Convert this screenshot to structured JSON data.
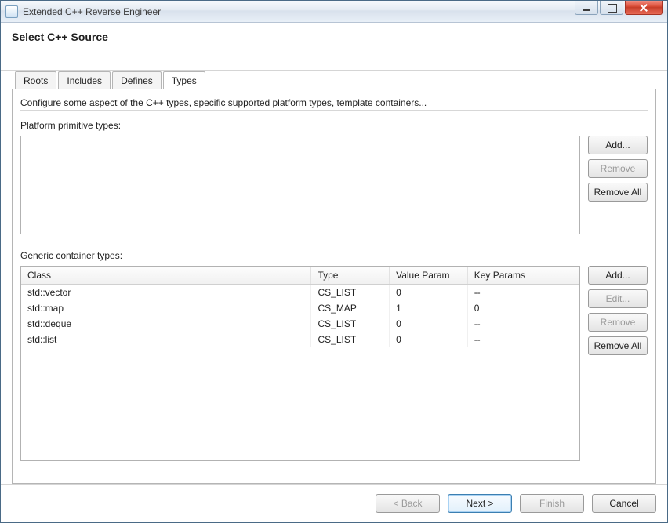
{
  "window": {
    "title": "Extended C++ Reverse Engineer"
  },
  "banner": {
    "heading": "Select C++ Source"
  },
  "tabs": [
    {
      "id": "roots",
      "label": "Roots",
      "active": false
    },
    {
      "id": "includes",
      "label": "Includes",
      "active": false
    },
    {
      "id": "defines",
      "label": "Defines",
      "active": false
    },
    {
      "id": "types",
      "label": "Types",
      "active": true
    }
  ],
  "panel": {
    "description": "Configure some aspect of the C++ types, specific supported platform types, template containers...",
    "primitive_label": "Platform primitive types:",
    "container_label": "Generic container types:"
  },
  "primitive_buttons": {
    "add": "Add...",
    "remove": "Remove",
    "remove_all": "Remove All"
  },
  "container_buttons": {
    "add": "Add...",
    "edit": "Edit...",
    "remove": "Remove",
    "remove_all": "Remove All"
  },
  "table": {
    "headers": {
      "class": "Class",
      "type": "Type",
      "value_param": "Value Param",
      "key_params": "Key Params"
    },
    "rows": [
      {
        "class": "std::vector",
        "type": "CS_LIST",
        "value_param": "0",
        "key_params": "--"
      },
      {
        "class": "std::map",
        "type": "CS_MAP",
        "value_param": "1",
        "key_params": "0"
      },
      {
        "class": "std::deque",
        "type": "CS_LIST",
        "value_param": "0",
        "key_params": "--"
      },
      {
        "class": "std::list",
        "type": "CS_LIST",
        "value_param": "0",
        "key_params": "--"
      }
    ]
  },
  "footer": {
    "back": "< Back",
    "next": "Next >",
    "finish": "Finish",
    "cancel": "Cancel"
  }
}
